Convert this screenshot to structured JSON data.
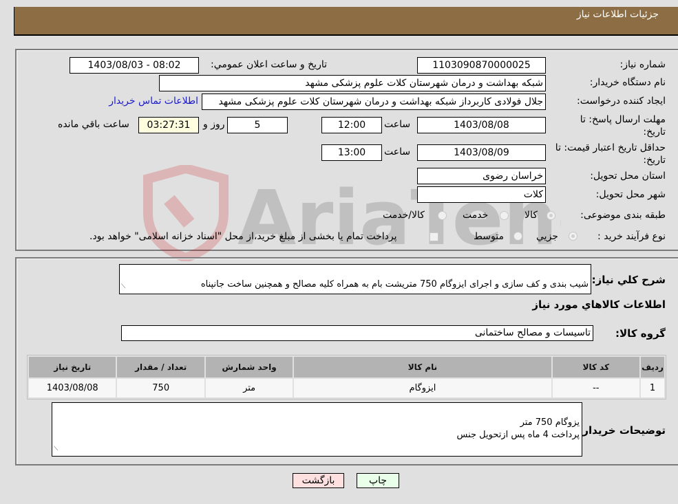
{
  "header": {
    "title": "جزئیات اطلاعات نیاز"
  },
  "fields": {
    "need_number": {
      "label": "شماره نیاز:",
      "value": "1103090870000025"
    },
    "announce_datetime": {
      "label": "تاریخ و ساعت اعلان عمومي:",
      "value": "1403/08/03 - 08:02"
    },
    "buyer_org": {
      "label": "نام دستگاه خریدار:",
      "value": "شبکه بهداشت و درمان شهرستان کلات   علوم پزشکی مشهد"
    },
    "requester": {
      "label": "ایجاد کننده درخواست:",
      "value": "جلال فولادی کاربرداز شبکه بهداشت و درمان شهرستان کلات   علوم پزشکی مشهد"
    },
    "buyer_contact_link": "اطلاعات تماس خریدار",
    "reply_deadline": {
      "label": "مهلت ارسال پاسخ: تا تاریخ:",
      "date": "1403/08/08",
      "time_label": "ساعت",
      "time": "12:00",
      "days": "5",
      "days_label": "روز و",
      "remaining": "03:27:31",
      "remaining_label": "ساعت باقي مانده"
    },
    "price_validity": {
      "label": "حداقل تاریخ اعتبار قیمت: تا تاریخ:",
      "date": "1403/08/09",
      "time_label": "ساعت",
      "time": "13:00"
    },
    "delivery_province": {
      "label": "استان محل تحویل:",
      "value": "خراسان رضوی"
    },
    "delivery_city": {
      "label": "شهر محل تحویل:",
      "value": "کلات"
    },
    "subject_category": {
      "label": "طبقه بندی موضوعی:",
      "options": [
        "کالا",
        "خدمت",
        "کالا/خدمت"
      ],
      "selected": "کالا"
    },
    "purchase_type": {
      "label": "نوع فرآیند خرید :",
      "options": [
        "جزیي",
        "متوسط"
      ],
      "selected": "جزیي",
      "treasury_note": "پرداخت تمام یا بخشی از مبلغ خرید،از محل \"اسناد خزانه اسلامی\" خواهد بود."
    }
  },
  "description": {
    "label": "شرح کلي نیاز:",
    "value": "شیب بندی و کف سازی و اجرای ایزوگام 750 متریشت بام به همراه کلیه مصالح و همچنین ساخت جانپناه"
  },
  "goods_section": {
    "title": "اطلاعات کالاهاي مورد نیاز",
    "group_label": "گروه کالا:",
    "group_value": "تاسیسات و مصالح ساختمانی",
    "table": {
      "columns": [
        "ردیف",
        "کد کالا",
        "نام کالا",
        "واحد شمارش",
        "تعداد / مقدار",
        "تاریخ نیاز"
      ],
      "rows": [
        [
          "1",
          "--",
          "ایزوگام",
          "متر",
          "750",
          "1403/08/08"
        ]
      ]
    }
  },
  "buyer_notes": {
    "label": "توضیحات خریدار:",
    "value": "یزوگام 750 متر\nپرداخت 4 ماه پس ازتحویل جنس"
  },
  "buttons": {
    "print": "چاپ",
    "back": "بازگشت"
  },
  "watermark": {
    "text": "AriaTender.neT"
  },
  "colors": {
    "header_bg": "#8d6e44",
    "link": "#1a1acc",
    "timer_bg": "#ffffe0",
    "print_bg": "#eaffea",
    "back_bg": "#ffe0e0"
  }
}
